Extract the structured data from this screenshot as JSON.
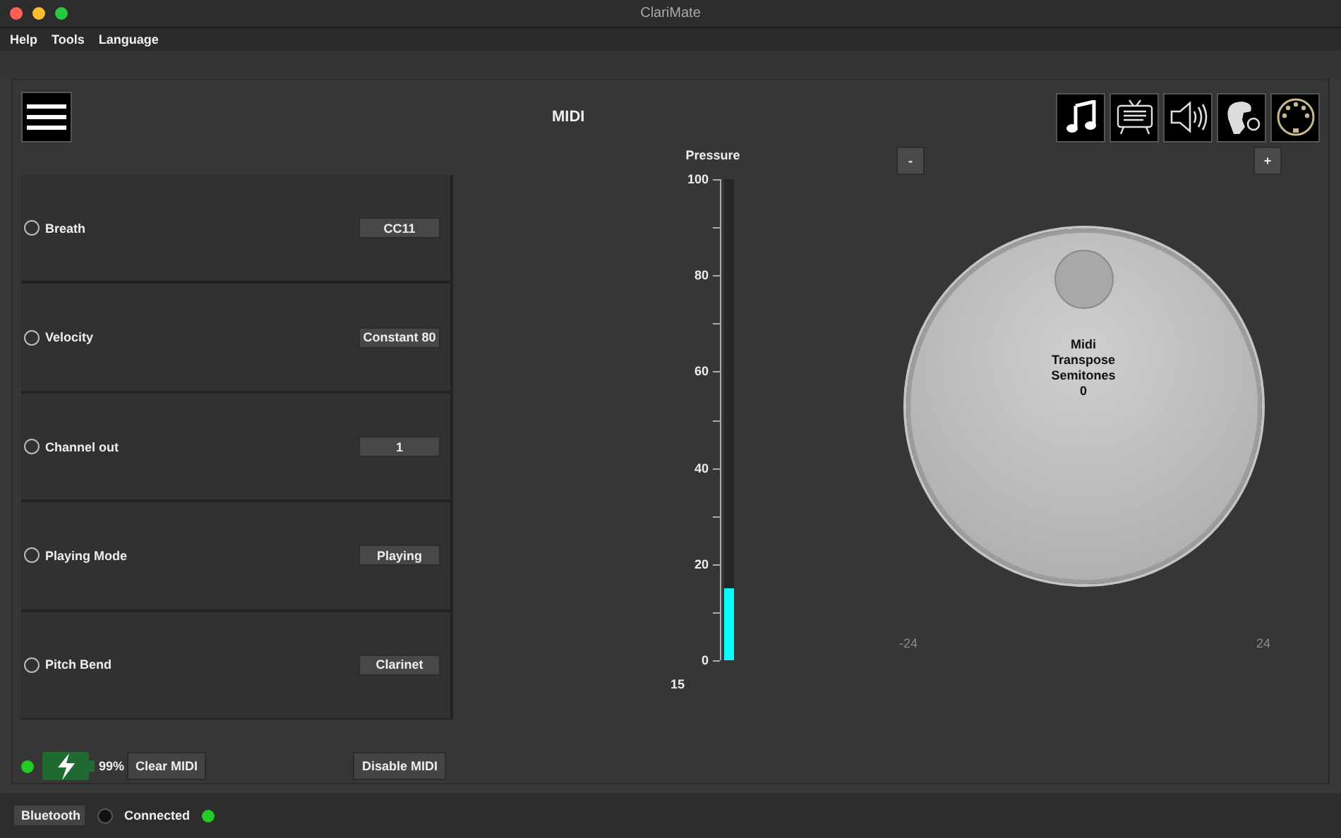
{
  "window": {
    "title": "ClariMate"
  },
  "menu": [
    "Help",
    "Tools",
    "Language"
  ],
  "header": {
    "title": "MIDI"
  },
  "toolbar": [
    {
      "kind": "note"
    },
    {
      "kind": "screen"
    },
    {
      "kind": "speaker"
    },
    {
      "kind": "head"
    },
    {
      "kind": "midi"
    }
  ],
  "settings": [
    {
      "label": "Breath",
      "value": "CC11",
      "selected": false
    },
    {
      "label": "Velocity",
      "value": "Constant 80",
      "selected": false
    },
    {
      "label": "Channel out",
      "value": "1",
      "selected": false
    },
    {
      "label": "Playing Mode",
      "value": "Playing",
      "selected": false
    },
    {
      "label": "Pitch Bend",
      "value": "Clarinet",
      "selected": false
    }
  ],
  "pressure": {
    "label": "Pressure",
    "level": 0.15,
    "reading": "15",
    "ticks": [
      "100",
      "80",
      "60",
      "40",
      "20",
      "0"
    ]
  },
  "knob": {
    "minus": "-",
    "plus": "+",
    "lines": [
      "Midi",
      "Transpose",
      "Semitones",
      "0"
    ],
    "level": 0.5,
    "min": "-24",
    "max": "24"
  },
  "footer": {
    "power_on": true,
    "battery": "99%",
    "clear": "Clear MIDI",
    "disable": "Disable MIDI"
  },
  "status_bar": {
    "button": "Bluetooth",
    "radio_selected": false,
    "status": "Connected",
    "connected": true
  }
}
